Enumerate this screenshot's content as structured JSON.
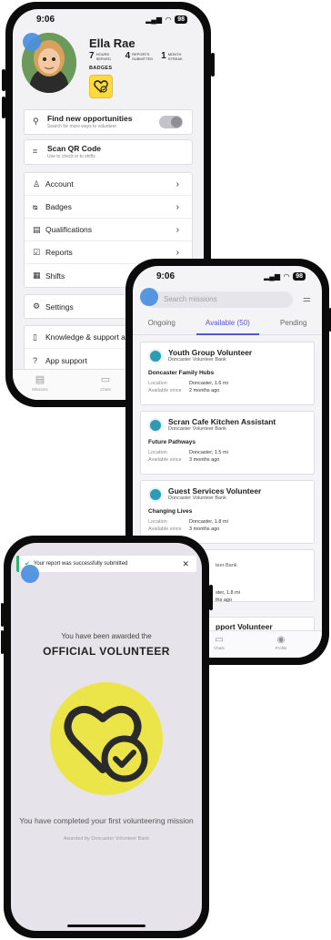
{
  "phone1": {
    "status": {
      "time": "9:06",
      "battery": "98"
    },
    "profile": {
      "name": "Ella Rae",
      "stats": [
        {
          "value": "7",
          "label": "HOURS SERVED"
        },
        {
          "value": "4",
          "label": "REPORTS SUBMITTED"
        },
        {
          "value": "1",
          "label": "MONTH STREAK"
        }
      ],
      "badges_label": "BADGES"
    },
    "find": {
      "title": "Find new opportunities",
      "subtitle": "Search for more ways to volunteer"
    },
    "scan": {
      "title": "Scan QR Code",
      "subtitle": "Use to check in to shifts"
    },
    "menu": [
      {
        "label": "Account",
        "icon": "person-icon"
      },
      {
        "label": "Badges",
        "icon": "medal-icon"
      },
      {
        "label": "Qualifications",
        "icon": "id-card-icon"
      },
      {
        "label": "Reports",
        "icon": "clipboard-icon"
      },
      {
        "label": "Shifts",
        "icon": "calendar-icon"
      }
    ],
    "settings": "Settings",
    "knowledge": "Knowledge & support a",
    "app_support": "App support",
    "tabs": [
      "Missions",
      "Chats"
    ]
  },
  "phone2": {
    "status": {
      "time": "9:06",
      "battery": "98"
    },
    "search_placeholder": "Search missions",
    "tabs": [
      {
        "label": "Ongoing",
        "active": false
      },
      {
        "label": "Available (50)",
        "active": true
      },
      {
        "label": "Pending",
        "active": false
      }
    ],
    "location_key": "Location",
    "since_key": "Available since",
    "opportunities": [
      {
        "title": "Youth Group Volunteer",
        "org": "Doncaster Volunteer Bank",
        "project": "Doncaster Family Hubs",
        "location": "Doncaster, 1.6 mi",
        "since": "2 months ago"
      },
      {
        "title": "Scran Cafe Kitchen Assistant",
        "org": "Doncaster Volunteer Bank",
        "project": "Future Pathways",
        "location": "Doncaster, 1.5 mi",
        "since": "3 months ago"
      },
      {
        "title": "Guest Services Volunteer",
        "org": "Doncaster Volunteer Bank",
        "project": "Changing Lives",
        "location": "Doncaster, 1.8 mi",
        "since": "3 months ago"
      }
    ],
    "partial_card": {
      "org": "teer Bank",
      "location": "ster, 1.8 mi",
      "since": "ths ago"
    },
    "partial_title": "pport Volunteer",
    "nav": [
      "Chats",
      "Profile"
    ]
  },
  "phone3": {
    "toast": "Your report was successfully submitted",
    "awarded_line": "You have been awarded the",
    "badge_title": "OFFICIAL VOLUNTEER",
    "message": "You have completed your first volunteering mission",
    "awarded_by": "Awarded by Doncaster Volunteer Bank"
  },
  "colors": {
    "accent": "#5a55d2",
    "badge_yellow": "#ece54a",
    "success": "#33b06a",
    "touch_dot": "#4a8fe0"
  }
}
